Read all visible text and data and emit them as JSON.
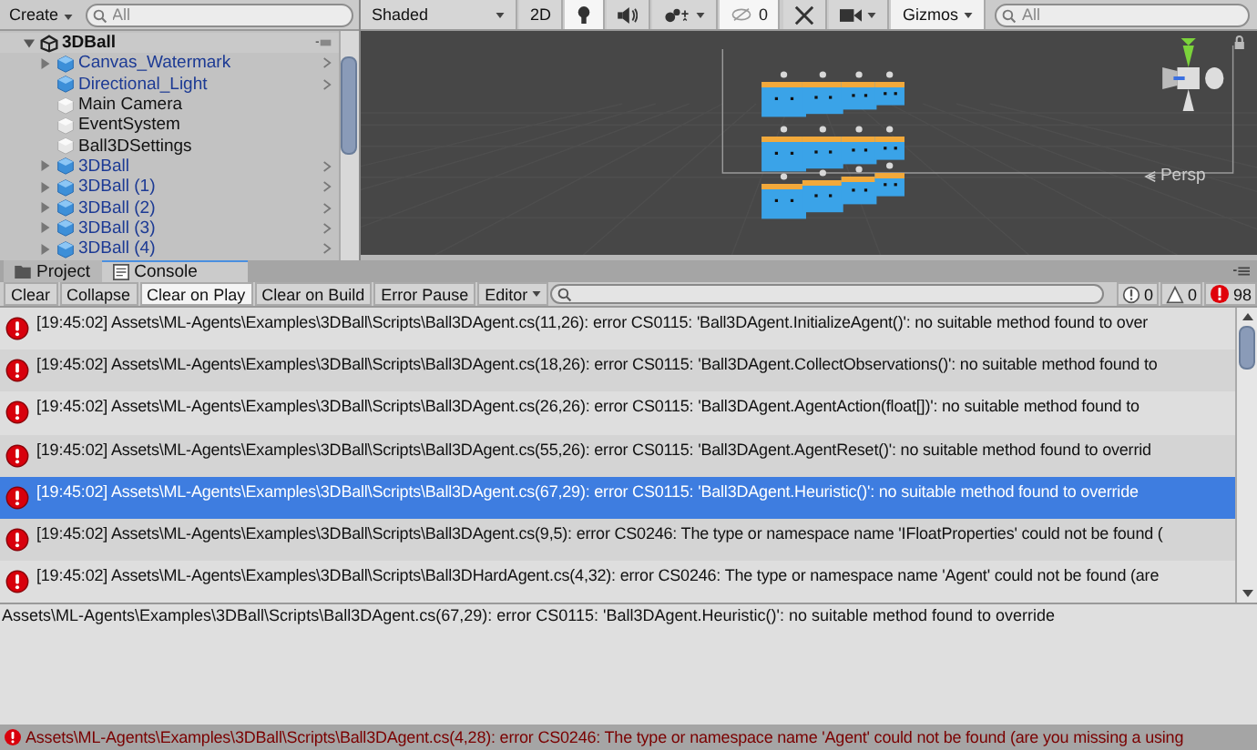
{
  "hierarchy": {
    "create_label": "Create",
    "search_placeholder": "All",
    "scene": {
      "name": "3DBall",
      "expanded": true
    },
    "items": [
      {
        "name": "Canvas_Watermark",
        "prefab": true,
        "has_children": true
      },
      {
        "name": "Directional_Light",
        "prefab": true,
        "has_children": false
      },
      {
        "name": "Main Camera",
        "prefab": false,
        "has_children": false
      },
      {
        "name": "EventSystem",
        "prefab": false,
        "has_children": false
      },
      {
        "name": "Ball3DSettings",
        "prefab": false,
        "has_children": false
      },
      {
        "name": "3DBall",
        "prefab": true,
        "has_children": true
      },
      {
        "name": "3DBall (1)",
        "prefab": true,
        "has_children": true
      },
      {
        "name": "3DBall (2)",
        "prefab": true,
        "has_children": true
      },
      {
        "name": "3DBall (3)",
        "prefab": true,
        "has_children": true
      },
      {
        "name": "3DBall (4)",
        "prefab": true,
        "has_children": true
      }
    ]
  },
  "scene_view": {
    "shading": "Shaded",
    "toggles": [
      {
        "kind": "dimension",
        "label": "2D",
        "on": false
      },
      {
        "kind": "lighting",
        "on": true
      },
      {
        "kind": "audio",
        "on": false
      },
      {
        "kind": "effects",
        "on": false
      }
    ],
    "hidden_count": "0",
    "gizmos": "Gizmos",
    "search_placeholder": "All",
    "projection": "Persp"
  },
  "console": {
    "tabs": [
      {
        "label": "Project",
        "selected": false
      },
      {
        "label": "Console",
        "selected": true
      }
    ],
    "toolbar": [
      {
        "label": "Clear",
        "on": false
      },
      {
        "label": "Collapse",
        "on": false
      },
      {
        "label": "Clear on Play",
        "on": true
      },
      {
        "label": "Clear on Build",
        "on": false
      },
      {
        "label": "Error Pause",
        "on": false
      }
    ],
    "editor_dropdown": "Editor",
    "counts": {
      "info": "0",
      "warnings": "0",
      "errors": "98"
    },
    "messages": [
      {
        "text": "[19:45:02] Assets\\ML-Agents\\Examples\\3DBall\\Scripts\\Ball3DAgent.cs(11,26): error CS0115: 'Ball3DAgent.InitializeAgent()': no suitable method found to over",
        "selected": false
      },
      {
        "text": "[19:45:02] Assets\\ML-Agents\\Examples\\3DBall\\Scripts\\Ball3DAgent.cs(18,26): error CS0115: 'Ball3DAgent.CollectObservations()': no suitable method found to",
        "selected": false
      },
      {
        "text": "[19:45:02] Assets\\ML-Agents\\Examples\\3DBall\\Scripts\\Ball3DAgent.cs(26,26): error CS0115: 'Ball3DAgent.AgentAction(float[])': no suitable method found to",
        "selected": false
      },
      {
        "text": "[19:45:02] Assets\\ML-Agents\\Examples\\3DBall\\Scripts\\Ball3DAgent.cs(55,26): error CS0115: 'Ball3DAgent.AgentReset()': no suitable method found to overrid",
        "selected": false
      },
      {
        "text": "[19:45:02] Assets\\ML-Agents\\Examples\\3DBall\\Scripts\\Ball3DAgent.cs(67,29): error CS0115: 'Ball3DAgent.Heuristic()': no suitable method found to override",
        "selected": true
      },
      {
        "text": "[19:45:02] Assets\\ML-Agents\\Examples\\3DBall\\Scripts\\Ball3DAgent.cs(9,5): error CS0246: The type or namespace name 'IFloatProperties' could not be found (",
        "selected": false
      },
      {
        "text": "[19:45:02] Assets\\ML-Agents\\Examples\\3DBall\\Scripts\\Ball3DHardAgent.cs(4,32): error CS0246: The type or namespace name 'Agent' could not be found (are",
        "selected": false
      }
    ],
    "detail": "Assets\\ML-Agents\\Examples\\3DBall\\Scripts\\Ball3DAgent.cs(67,29): error CS0115: 'Ball3DAgent.Heuristic()': no suitable method found to override",
    "status": "Assets\\ML-Agents\\Examples\\3DBall\\Scripts\\Ball3DAgent.cs(4,28): error CS0246: The type or namespace name 'Agent' could not be found (are you missing a using"
  }
}
